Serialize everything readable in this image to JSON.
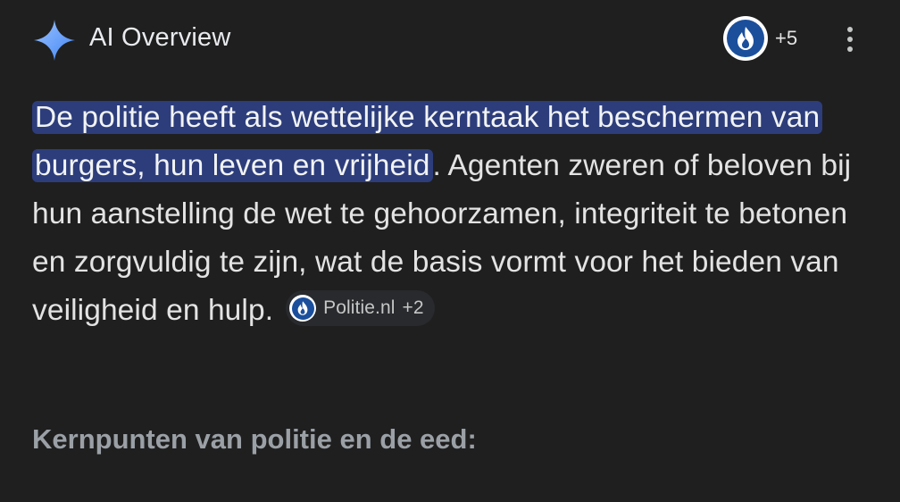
{
  "header": {
    "title": "AI Overview",
    "sparkle_icon": "gemini-sparkle-icon",
    "sparkle_colors": [
      "#4285f4",
      "#7fb3ff"
    ],
    "sources": {
      "icon": "politie-logo-icon",
      "count_label": "+5"
    },
    "more_icon": "more-vert-icon"
  },
  "answer": {
    "highlighted_text": "De politie heeft als wettelijke kerntaak het beschermen van burgers, hun leven en vrijheid",
    "body_text": ". Agenten zweren of beloven bij hun aanstelling de wet te gehoorzamen, integriteit te betonen en zorgvuldig te zijn, wat de basis vormt voor het bieden van veiligheid en hulp.",
    "highlight_color": "#2d3d7b",
    "citation": {
      "icon": "politie-logo-icon",
      "source_label": "Politie.nl",
      "more_label": "+2"
    }
  },
  "section": {
    "heading": "Kernpunten van politie en de eed:"
  }
}
